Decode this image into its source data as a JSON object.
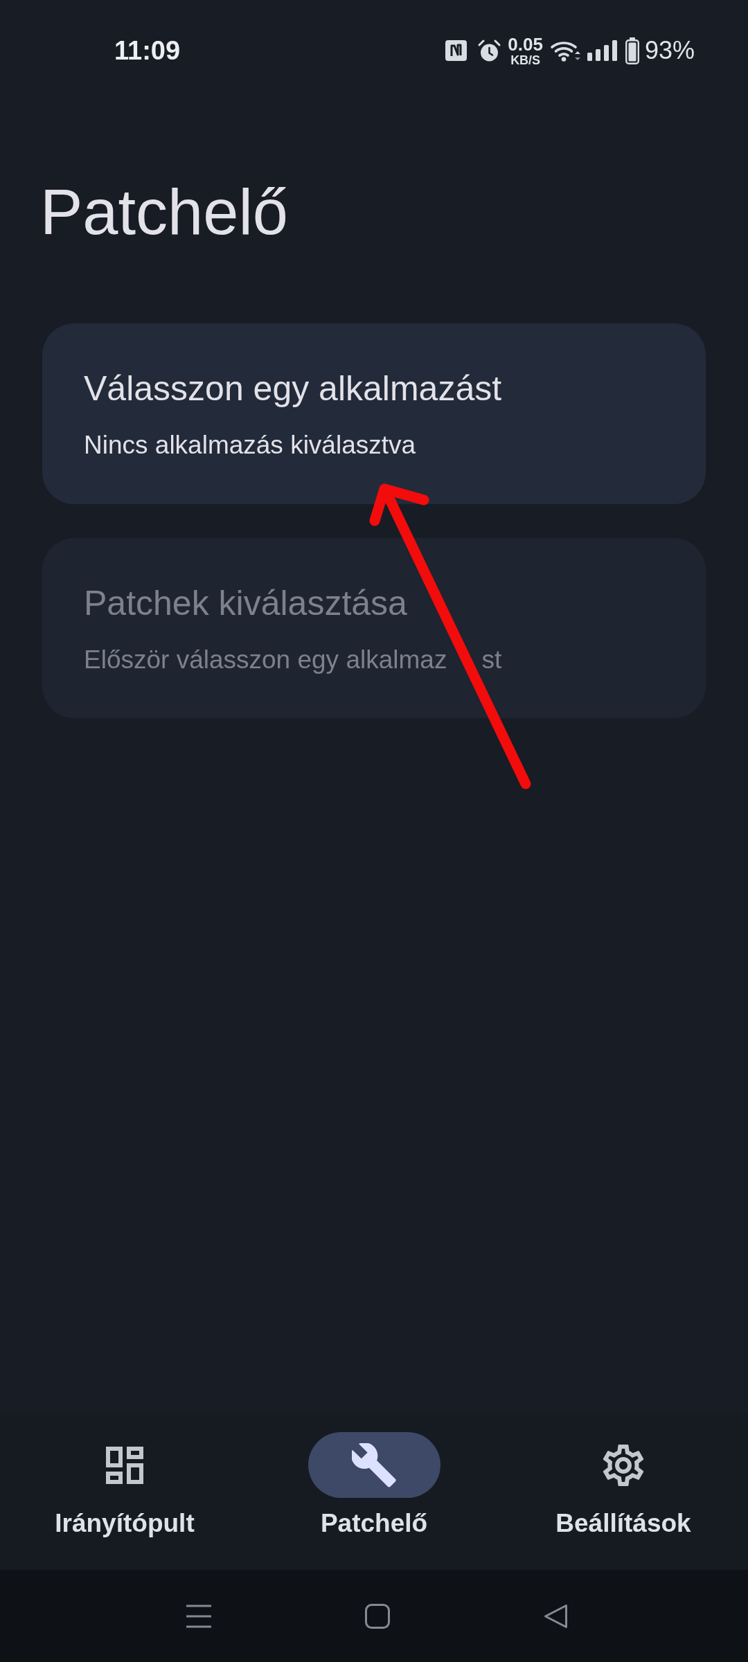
{
  "status_bar": {
    "time": "11:09",
    "network_speed": {
      "value": "0.05",
      "unit": "KB/S"
    },
    "battery": "93%"
  },
  "header": {
    "title": "Patchelő"
  },
  "cards": [
    {
      "title": "Válasszon egy alkalmazást",
      "subtitle": [
        "Nincs alkalmazás kiválasztva"
      ],
      "disabled": false
    },
    {
      "title": "Patchek kiválasztása",
      "subtitle": [
        "Először válasszon egy alkalmaz",
        "st"
      ],
      "disabled": true
    }
  ],
  "bottom_nav": [
    {
      "label": "Irányítópult",
      "selected": false
    },
    {
      "label": "Patchelő",
      "selected": true
    },
    {
      "label": "Beállítások",
      "selected": false
    }
  ]
}
